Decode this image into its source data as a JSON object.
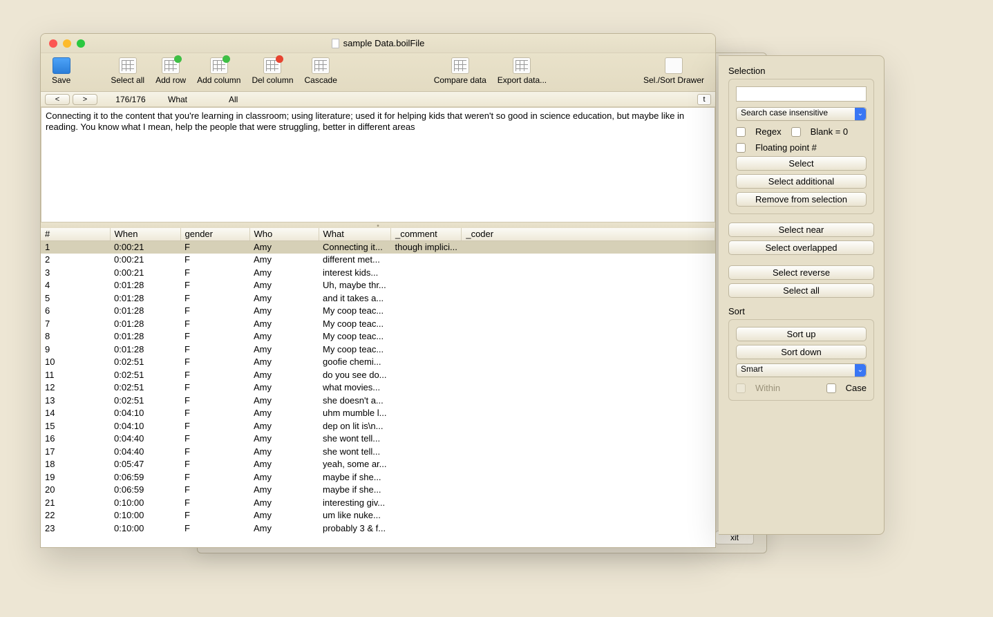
{
  "window": {
    "title": "sample Data.boilFile"
  },
  "bg": {
    "exit": "xit"
  },
  "toolbar": {
    "save": "Save",
    "select_all": "Select all",
    "add_row": "Add row",
    "add_column": "Add column",
    "del_column": "Del column",
    "cascade": "Cascade",
    "compare_data": "Compare data",
    "export_data": "Export data...",
    "sel_sort": "Sel./Sort Drawer"
  },
  "navbar": {
    "prev": "<",
    "next": ">",
    "counter": "176/176",
    "field": "What",
    "scope": "All",
    "t": "t"
  },
  "textpane": "Connecting it  to the content that you're learning in classroom; using literature; used it for helping kids that weren't so good in science education, but maybe like in reading. You know what I mean, help the people that were struggling, better in different areas",
  "columns": [
    "#",
    "When",
    "gender",
    "Who",
    "What",
    "_comment",
    "_coder"
  ],
  "rows": [
    {
      "n": "1",
      "when": "0:00:21",
      "gender": "F",
      "who": "Amy",
      "what": "Connecting it...",
      "comment": "though implici...",
      "coder": ""
    },
    {
      "n": "2",
      "when": "0:00:21",
      "gender": "F",
      "who": "Amy",
      "what": "different met...",
      "comment": "",
      "coder": ""
    },
    {
      "n": "3",
      "when": "0:00:21",
      "gender": "F",
      "who": "Amy",
      "what": "interest kids...",
      "comment": "",
      "coder": ""
    },
    {
      "n": "4",
      "when": "0:01:28",
      "gender": "F",
      "who": "Amy",
      "what": "Uh, maybe thr...",
      "comment": "",
      "coder": ""
    },
    {
      "n": "5",
      "when": "0:01:28",
      "gender": "F",
      "who": "Amy",
      "what": " and it takes a...",
      "comment": "",
      "coder": ""
    },
    {
      "n": "6",
      "when": "0:01:28",
      "gender": "F",
      "who": "Amy",
      "what": "My coop teac...",
      "comment": "",
      "coder": ""
    },
    {
      "n": "7",
      "when": "0:01:28",
      "gender": "F",
      "who": "Amy",
      "what": "My coop teac...",
      "comment": "",
      "coder": ""
    },
    {
      "n": "8",
      "when": "0:01:28",
      "gender": "F",
      "who": "Amy",
      "what": "My coop teac...",
      "comment": "",
      "coder": ""
    },
    {
      "n": "9",
      "when": "0:01:28",
      "gender": "F",
      "who": "Amy",
      "what": "My coop teac...",
      "comment": "",
      "coder": ""
    },
    {
      "n": "10",
      "when": "0:02:51",
      "gender": "F",
      "who": "Amy",
      "what": " goofie chemi...",
      "comment": "",
      "coder": ""
    },
    {
      "n": "11",
      "when": "0:02:51",
      "gender": "F",
      "who": "Amy",
      "what": "do you see do...",
      "comment": "",
      "coder": ""
    },
    {
      "n": "12",
      "when": "0:02:51",
      "gender": "F",
      "who": "Amy",
      "what": "what movies...",
      "comment": "",
      "coder": ""
    },
    {
      "n": "13",
      "when": "0:02:51",
      "gender": "F",
      "who": "Amy",
      "what": "she doesn't a...",
      "comment": "",
      "coder": ""
    },
    {
      "n": "14",
      "when": "0:04:10",
      "gender": "F",
      "who": "Amy",
      "what": "uhm mumble l...",
      "comment": "",
      "coder": ""
    },
    {
      "n": "15",
      "when": "0:04:10",
      "gender": "F",
      "who": "Amy",
      "what": "dep on lit is\\n...",
      "comment": "",
      "coder": ""
    },
    {
      "n": "16",
      "when": "0:04:40",
      "gender": "F",
      "who": "Amy",
      "what": "she wont tell...",
      "comment": "",
      "coder": ""
    },
    {
      "n": "17",
      "when": "0:04:40",
      "gender": "F",
      "who": "Amy",
      "what": "she wont tell...",
      "comment": "",
      "coder": ""
    },
    {
      "n": "18",
      "when": "0:05:47",
      "gender": "F",
      "who": "Amy",
      "what": "yeah, some ar...",
      "comment": "",
      "coder": ""
    },
    {
      "n": "19",
      "when": "0:06:59",
      "gender": "F",
      "who": "Amy",
      "what": "maybe if she...",
      "comment": "",
      "coder": ""
    },
    {
      "n": "20",
      "when": "0:06:59",
      "gender": "F",
      "who": "Amy",
      "what": "maybe if she...",
      "comment": "",
      "coder": ""
    },
    {
      "n": "21",
      "when": "0:10:00",
      "gender": "F",
      "who": "Amy",
      "what": "interesting giv...",
      "comment": "",
      "coder": ""
    },
    {
      "n": "22",
      "when": "0:10:00",
      "gender": "F",
      "who": "Amy",
      "what": "um like nuke...",
      "comment": "",
      "coder": ""
    },
    {
      "n": "23",
      "when": "0:10:00",
      "gender": "F",
      "who": "Amy",
      "what": "probably 3 & f...",
      "comment": "",
      "coder": ""
    }
  ],
  "drawer": {
    "selection_label": "Selection",
    "search_value": "",
    "search_mode": "Search case insensitive",
    "regex": "Regex",
    "blank0": "Blank = 0",
    "floatpt": "Floating point #",
    "select": "Select",
    "select_additional": "Select additional",
    "remove": "Remove from selection",
    "select_near": "Select near",
    "select_overlapped": "Select overlapped",
    "select_reverse": "Select reverse",
    "select_all": "Select all",
    "sort_label": "Sort",
    "sort_up": "Sort up",
    "sort_down": "Sort down",
    "sort_mode": "Smart",
    "within": "Within",
    "case": "Case"
  }
}
